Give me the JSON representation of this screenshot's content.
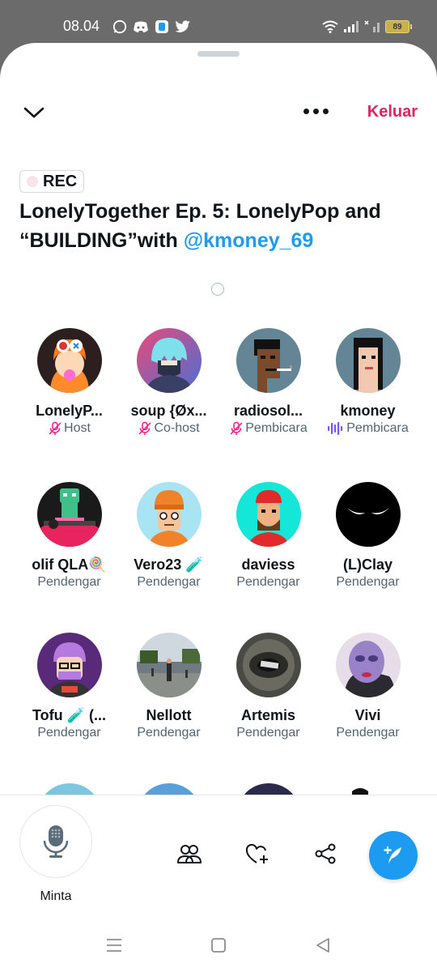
{
  "status_bar": {
    "time": "08.04",
    "battery": "89"
  },
  "header": {
    "leave_label": "Keluar"
  },
  "space": {
    "rec_label": "REC",
    "title_text": "LonelyTogether Ep. 5: LonelyPop and “BUILDING”with ",
    "title_mention": "@kmoney_69"
  },
  "participants": [
    {
      "name": "LonelyP...",
      "role": "Host",
      "role_icon": "mic-off-icon"
    },
    {
      "name": "soup {Øx...",
      "role": "Co-host",
      "role_icon": "mic-off-icon"
    },
    {
      "name": "radiosol...",
      "role": "Pembicara",
      "role_icon": "mic-off-icon"
    },
    {
      "name": "kmoney",
      "role": "Pembicara",
      "role_icon": "speaking-icon"
    },
    {
      "name": "olif QLA🍭",
      "role": "Pendengar"
    },
    {
      "name": "Vero23 🧪",
      "role": "Pendengar"
    },
    {
      "name": "daviess",
      "role": "Pendengar"
    },
    {
      "name": "(L)Clay",
      "role": "Pendengar"
    },
    {
      "name": "Tofu 🧪 (...",
      "role": "Pendengar"
    },
    {
      "name": "Nellott",
      "role": "Pendengar"
    },
    {
      "name": "Artemis",
      "role": "Pendengar"
    },
    {
      "name": "Vivi",
      "role": "Pendengar"
    }
  ],
  "bottom_bar": {
    "request_label": "Minta"
  },
  "colors": {
    "accent": "#1d9bf0",
    "leave": "#e0245e",
    "muted": "#e0245e",
    "speaking": "#7856ff"
  }
}
